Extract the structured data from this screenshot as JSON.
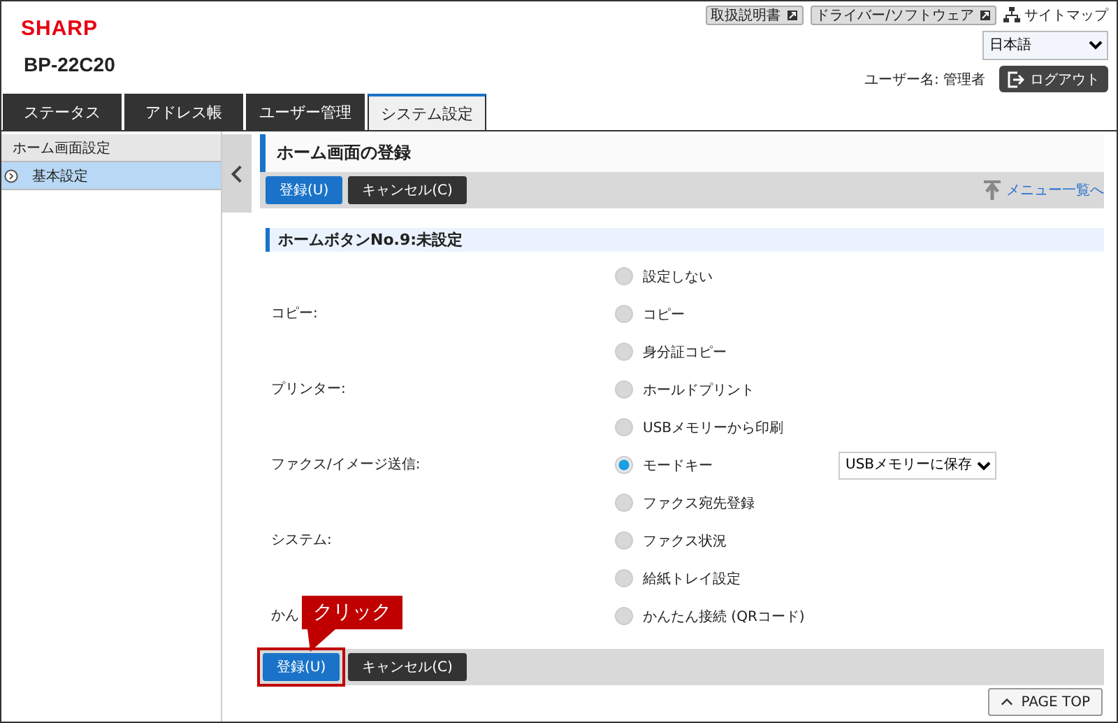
{
  "header": {
    "logo": "SHARP",
    "model": "BP-22C20",
    "links": [
      {
        "label": "取扱説明書"
      },
      {
        "label": "ドライバー/ソフトウェア"
      }
    ],
    "sitemap": "サイトマップ",
    "language": "日本語",
    "user": "ユーザー名: 管理者",
    "logout": "ログアウト"
  },
  "tabs": [
    {
      "label": "ステータス",
      "selected": false
    },
    {
      "label": "アドレス帳",
      "selected": false
    },
    {
      "label": "ユーザー管理",
      "selected": false
    },
    {
      "label": "システム設定",
      "selected": true
    }
  ],
  "sidebar": {
    "items": [
      {
        "label": "ホーム画面設定",
        "selected": false,
        "kind": "heading"
      },
      {
        "label": "基本設定",
        "selected": true,
        "kind": "item"
      }
    ]
  },
  "page_title": "ホーム画面の登録",
  "toolbar": {
    "buttons": [
      {
        "label": "登録(U)",
        "kind": "primary"
      },
      {
        "label": "キャンセル(C)",
        "kind": "secondary"
      }
    ],
    "menu_link": "メニュー一覧へ"
  },
  "section_title": "ホームボタンNo.9:未設定",
  "options": [
    {
      "label": "設定しない",
      "selected": false
    },
    {
      "category": "コピー:",
      "label": "コピー",
      "selected": false
    },
    {
      "label": "身分証コピー",
      "selected": false
    },
    {
      "category": "プリンター:",
      "label": "ホールドプリント",
      "selected": false
    },
    {
      "label": "USBメモリーから印刷",
      "selected": false
    },
    {
      "category": "ファクス/イメージ送信:",
      "label": "モードキー",
      "selected": true,
      "select": "USBメモリーに保存"
    },
    {
      "label": "ファクス宛先登録",
      "selected": false
    },
    {
      "category": "システム:",
      "label": "ファクス状況",
      "selected": false
    },
    {
      "label": "給紙トレイ設定",
      "selected": false
    },
    {
      "category": "かん",
      "label": "かんたん接続 (QRコード)",
      "selected": false
    }
  ],
  "bottom_toolbar": {
    "buttons": [
      {
        "label": "登録(U)",
        "kind": "primary",
        "highlighted": true
      },
      {
        "label": "キャンセル(C)",
        "kind": "secondary",
        "highlighted": false
      }
    ]
  },
  "page_top": "PAGE TOP",
  "callout": "クリック"
}
